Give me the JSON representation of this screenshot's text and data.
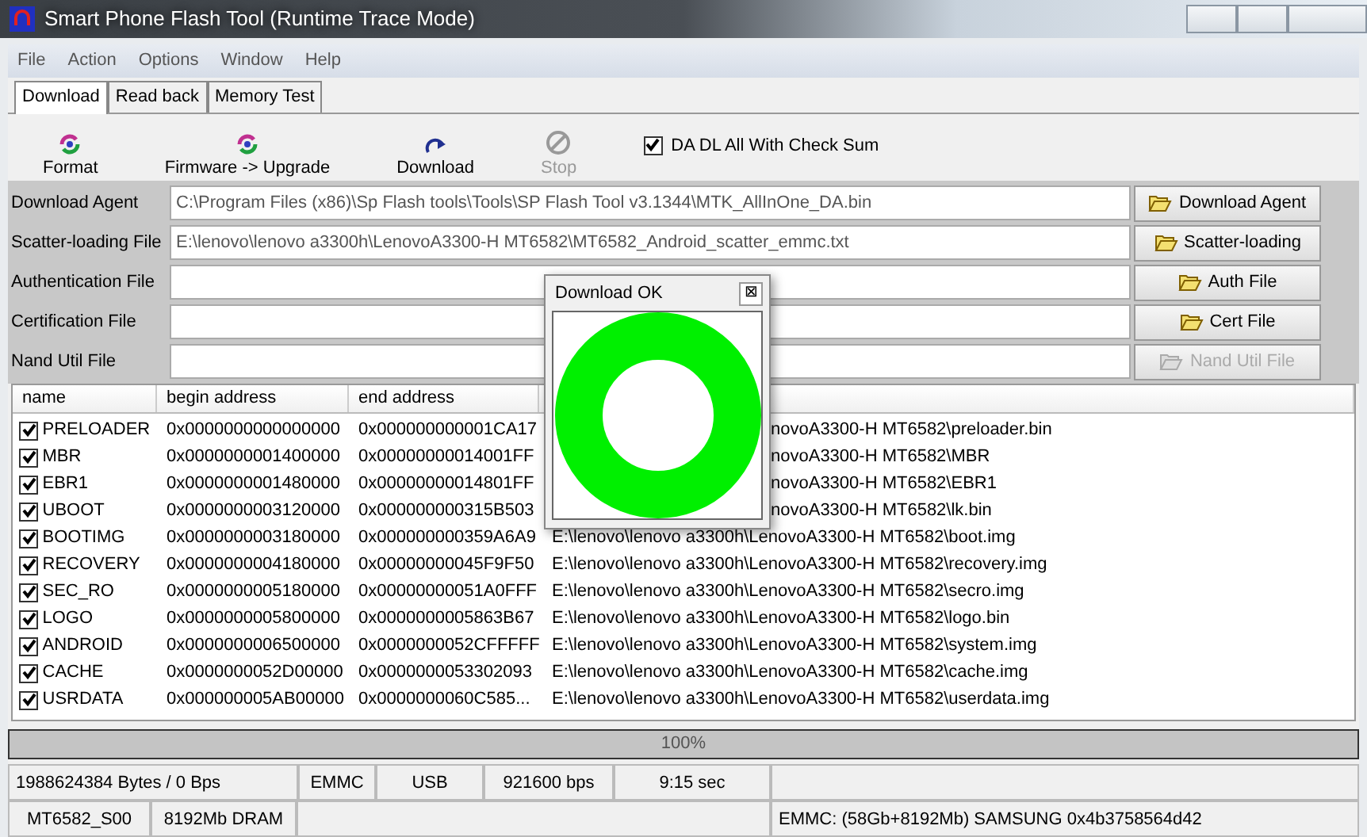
{
  "window": {
    "title": "Smart Phone Flash Tool (Runtime Trace Mode)"
  },
  "menu": [
    "File",
    "Action",
    "Options",
    "Window",
    "Help"
  ],
  "tabs": [
    {
      "label": "Download",
      "selected": true
    },
    {
      "label": "Read back",
      "selected": false
    },
    {
      "label": "Memory Test",
      "selected": false
    }
  ],
  "toolbar": [
    {
      "label": "Format",
      "kind": "arrows",
      "disabled": false
    },
    {
      "label": "Firmware -> Upgrade",
      "kind": "arrows",
      "disabled": false
    },
    {
      "label": "Download",
      "kind": "redo",
      "disabled": false
    },
    {
      "label": "Stop",
      "kind": "stop",
      "disabled": true
    }
  ],
  "checksum": {
    "label": "DA DL All With Check Sum",
    "checked": true
  },
  "files": [
    {
      "label": "Download Agent",
      "value": "C:\\Program Files (x86)\\Sp Flash tools\\Tools\\SP Flash Tool v3.1344\\MTK_AllInOne_DA.bin",
      "button": "Download Agent",
      "disabled": false
    },
    {
      "label": "Scatter-loading File",
      "value": "E:\\lenovo\\lenovo a3300h\\LenovoA3300-H MT6582\\MT6582_Android_scatter_emmc.txt",
      "button": "Scatter-loading",
      "disabled": false
    },
    {
      "label": "Authentication File",
      "button": "Auth File",
      "disabled": false
    },
    {
      "label": "Certification File",
      "button": "Cert File",
      "disabled": false
    },
    {
      "label": "Nand Util File",
      "button": "Nand Util File",
      "disabled": true
    }
  ],
  "table": {
    "columns": [
      "name",
      "begin address",
      "end address"
    ],
    "rows": [
      {
        "name": "PRELOADER",
        "begin": "0x0000000000000000",
        "end": "0x000000000001CA17",
        "path": "novoA3300-H MT6582\\preloader.bin",
        "checked": true,
        "partly_hidden": true
      },
      {
        "name": "MBR",
        "begin": "0x0000000001400000",
        "end": "0x00000000014001FF",
        "path": "novoA3300-H MT6582\\MBR",
        "checked": true,
        "partly_hidden": true
      },
      {
        "name": "EBR1",
        "begin": "0x0000000001480000",
        "end": "0x00000000014801FF",
        "path": "novoA3300-H MT6582\\EBR1",
        "checked": true,
        "partly_hidden": true
      },
      {
        "name": "UBOOT",
        "begin": "0x0000000003120000",
        "end": "0x000000000315B503",
        "path": "novoA3300-H MT6582\\lk.bin",
        "checked": true,
        "partly_hidden": true
      },
      {
        "name": "BOOTIMG",
        "begin": "0x0000000003180000",
        "end": "0x000000000359A6A9",
        "path": "E:\\lenovo\\lenovo a3300h\\LenovoA3300-H MT6582\\boot.img",
        "checked": true,
        "partly_hidden": false
      },
      {
        "name": "RECOVERY",
        "begin": "0x0000000004180000",
        "end": "0x00000000045F9F50",
        "path": "E:\\lenovo\\lenovo a3300h\\LenovoA3300-H MT6582\\recovery.img",
        "checked": true,
        "partly_hidden": false
      },
      {
        "name": "SEC_RO",
        "begin": "0x0000000005180000",
        "end": "0x00000000051A0FFF",
        "path": "E:\\lenovo\\lenovo a3300h\\LenovoA3300-H MT6582\\secro.img",
        "checked": true,
        "partly_hidden": false
      },
      {
        "name": "LOGO",
        "begin": "0x0000000005800000",
        "end": "0x0000000005863B67",
        "path": "E:\\lenovo\\lenovo a3300h\\LenovoA3300-H MT6582\\logo.bin",
        "checked": true,
        "partly_hidden": false
      },
      {
        "name": "ANDROID",
        "begin": "0x0000000006500000",
        "end": "0x0000000052CFFFFF",
        "path": "E:\\lenovo\\lenovo a3300h\\LenovoA3300-H MT6582\\system.img",
        "checked": true,
        "partly_hidden": false
      },
      {
        "name": "CACHE",
        "begin": "0x0000000052D00000",
        "end": "0x0000000053302093",
        "path": "E:\\lenovo\\lenovo a3300h\\LenovoA3300-H MT6582\\cache.img",
        "checked": true,
        "partly_hidden": false
      },
      {
        "name": "USRDATA",
        "begin": "0x000000005AB00000",
        "end": "0x0000000060C585...",
        "path": "E:\\lenovo\\lenovo a3300h\\LenovoA3300-H MT6582\\userdata.img",
        "checked": true,
        "partly_hidden": false
      }
    ]
  },
  "dialog": {
    "title": "Download OK",
    "close": "⊠"
  },
  "progress": {
    "level": 1,
    "text": "100%"
  },
  "status_bar": [
    [
      {
        "kind": "text",
        "text": "1988624384 Bytes / 0 Bps"
      },
      {
        "kind": "text",
        "text": "EMMC"
      },
      {
        "kind": "text",
        "text": "USB"
      },
      {
        "kind": "text",
        "text": "921600 bps"
      },
      {
        "kind": "text",
        "text": "9:15 sec"
      },
      {
        "kind": "blank"
      }
    ],
    [
      {
        "kind": "text",
        "text": "MT6582_S00"
      },
      {
        "kind": "text",
        "text": "8192Mb DRAM"
      },
      {
        "kind": "blank"
      },
      {
        "kind": "text",
        "text": "EMMC: (58Gb+8192Mb) SAMSUNG 0x4b3758564d42"
      }
    ]
  ]
}
